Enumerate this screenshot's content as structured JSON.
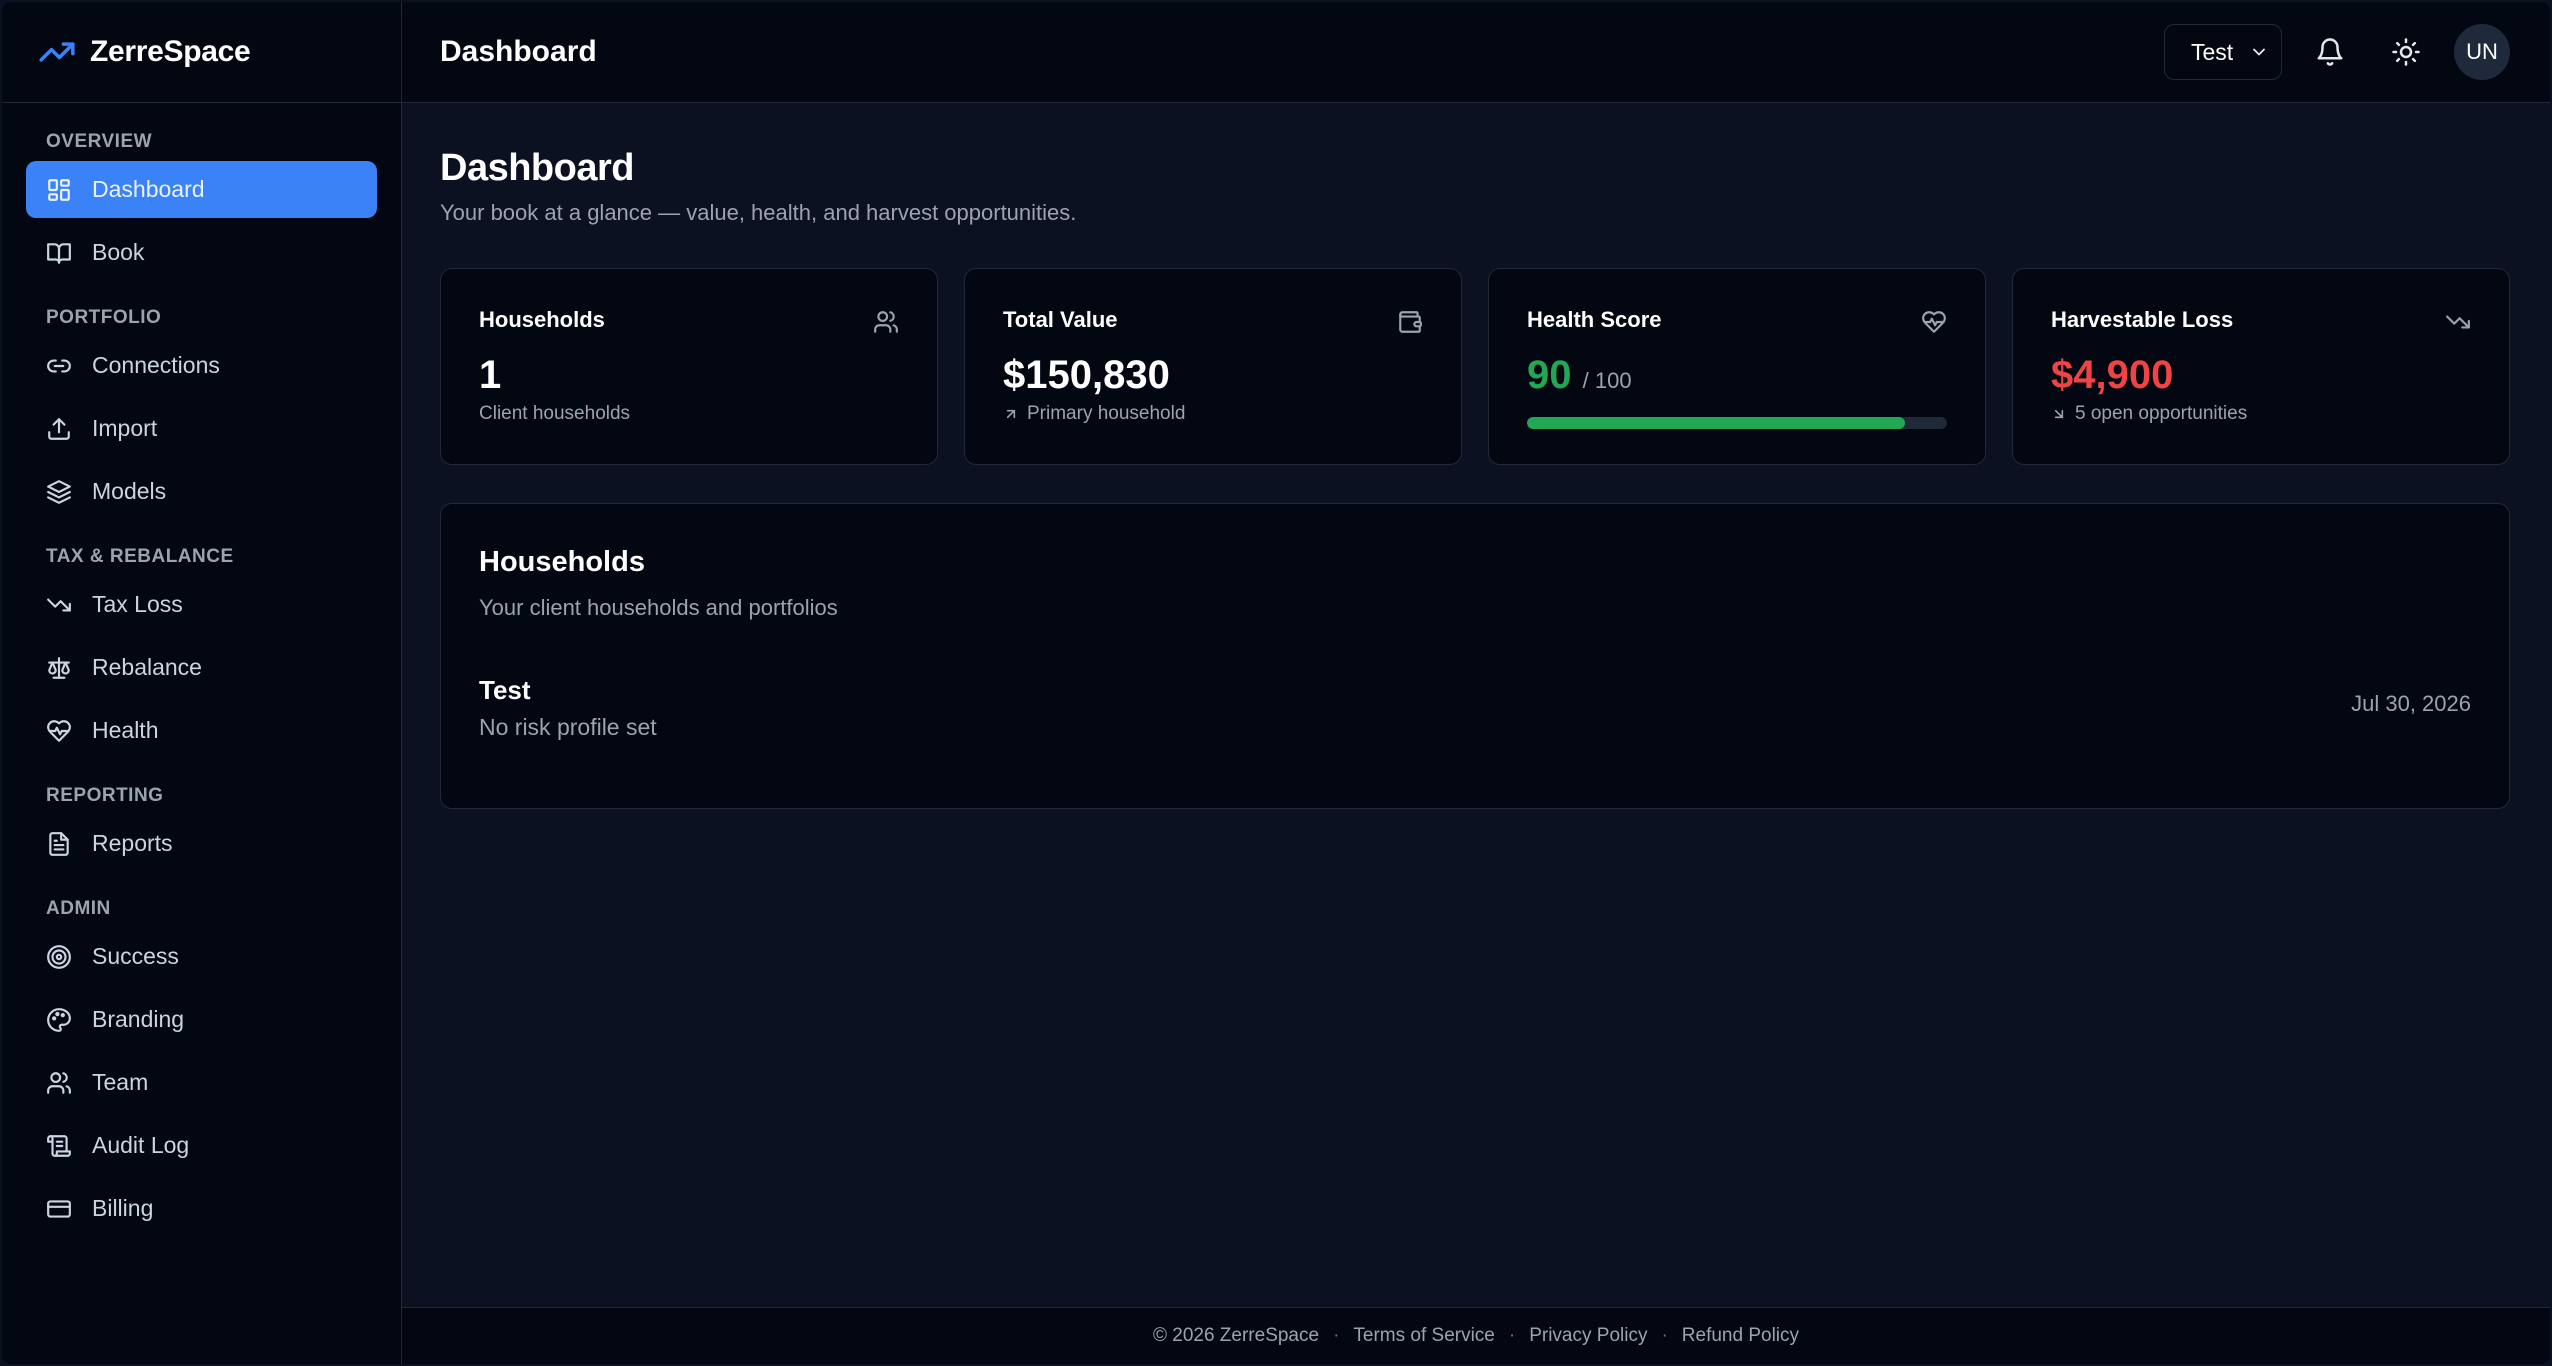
{
  "brand": {
    "name": "ZerreSpace"
  },
  "sidebar": {
    "sections": {
      "overview": "OVERVIEW",
      "portfolio": "PORTFOLIO",
      "tax_rebalance": "TAX & REBALANCE",
      "reporting": "REPORTING",
      "admin": "ADMIN"
    },
    "items": {
      "dashboard": "Dashboard",
      "book": "Book",
      "connections": "Connections",
      "import": "Import",
      "models": "Models",
      "tax_loss": "Tax Loss",
      "rebalance": "Rebalance",
      "health": "Health",
      "reports": "Reports",
      "success": "Success",
      "branding": "Branding",
      "team": "Team",
      "audit_log": "Audit Log",
      "billing": "Billing"
    },
    "active_item": "Dashboard"
  },
  "topbar": {
    "title": "Dashboard",
    "household_select": "Test",
    "avatar_initials": "UN"
  },
  "page": {
    "title": "Dashboard",
    "subtitle": "Your book at a glance — value, health, and harvest opportunities."
  },
  "stats": {
    "households": {
      "label": "Households",
      "value": "1",
      "sub": "Client households"
    },
    "total_value": {
      "label": "Total Value",
      "value": "$150,830",
      "sub": "Primary household"
    },
    "health_score": {
      "label": "Health Score",
      "value": "90",
      "suffix": "/ 100",
      "progress": 0.9
    },
    "harvestable_loss": {
      "label": "Harvestable Loss",
      "value": "$4,900",
      "sub": "5 open opportunities"
    }
  },
  "households_panel": {
    "title": "Households",
    "subtitle": "Your client households and portfolios",
    "rows": [
      {
        "name": "Test",
        "risk": "No risk profile set",
        "date": "Jul 30, 2026"
      }
    ]
  },
  "footer": {
    "copyright": "© 2026 ZerreSpace",
    "separator": "·",
    "terms": "Terms of Service",
    "privacy": "Privacy Policy",
    "refund": "Refund Policy"
  },
  "colors": {
    "accent": "#3b82f6",
    "positive": "#22a855",
    "negative": "#ef4444",
    "background": "#0b1120",
    "surface": "#030712"
  }
}
